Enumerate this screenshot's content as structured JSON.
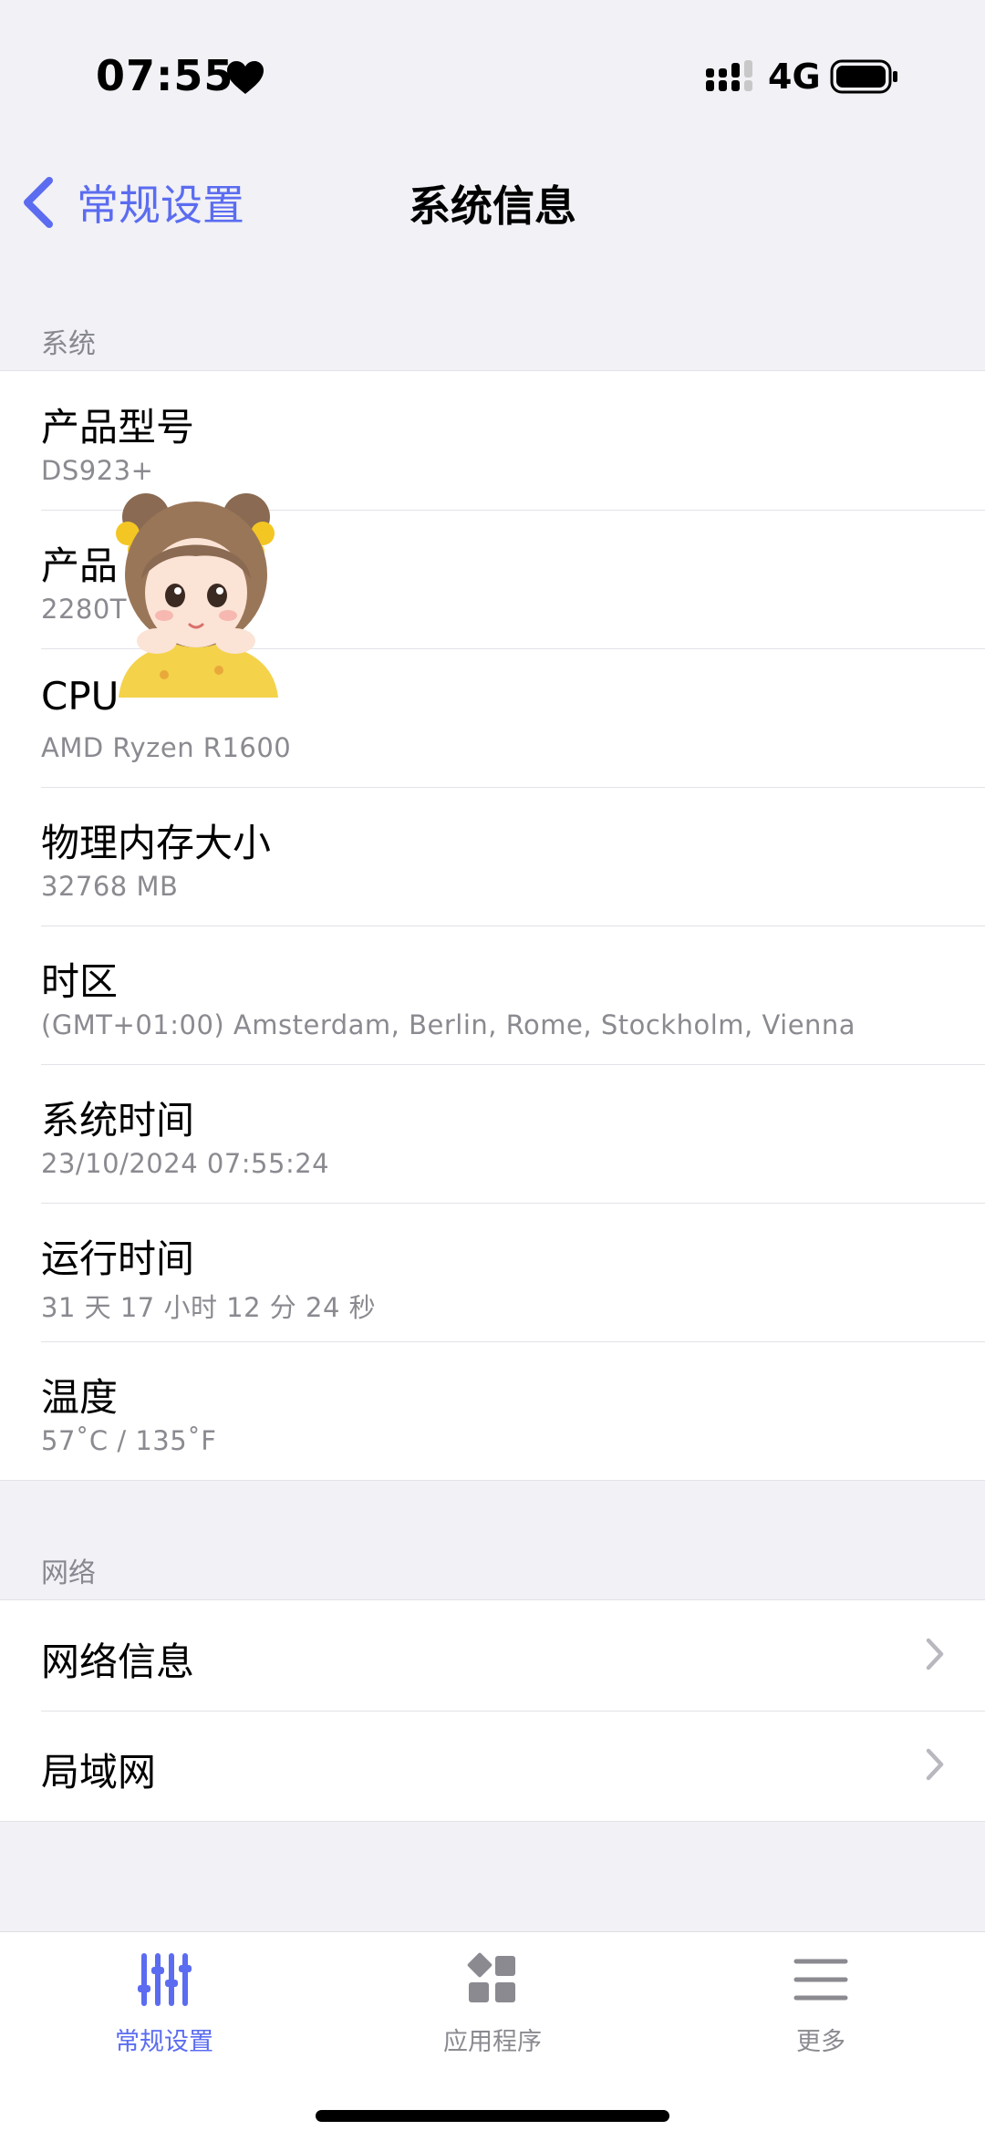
{
  "status_bar": {
    "time": "07:55",
    "network": "4G"
  },
  "nav": {
    "back_label": "常规设置",
    "title": "系统信息"
  },
  "accent_color": "#5b6cf0",
  "sections": {
    "system": {
      "header": "系统",
      "rows": [
        {
          "title": "产品型号",
          "value": "DS923+"
        },
        {
          "title": "产品",
          "value": "2280T"
        },
        {
          "title": "CPU",
          "value": "AMD Ryzen R1600"
        },
        {
          "title": "物理内存大小",
          "value": "32768 MB"
        },
        {
          "title": "时区",
          "value": "(GMT+01:00) Amsterdam, Berlin, Rome, Stockholm, Vienna"
        },
        {
          "title": "系统时间",
          "value": "23/10/2024 07:55:24"
        },
        {
          "title": "运行时间",
          "value": "31 天 17 小时 12 分 24 秒"
        },
        {
          "title": "温度",
          "value": "57˚C / 135˚F"
        }
      ]
    },
    "network": {
      "header": "网络",
      "rows": [
        {
          "title": "网络信息"
        },
        {
          "title": "局域网"
        }
      ]
    }
  },
  "tabs": [
    {
      "label": "常规设置",
      "icon": "sliders-icon",
      "active": true
    },
    {
      "label": "应用程序",
      "icon": "apps-icon",
      "active": false
    },
    {
      "label": "更多",
      "icon": "menu-icon",
      "active": false
    }
  ]
}
